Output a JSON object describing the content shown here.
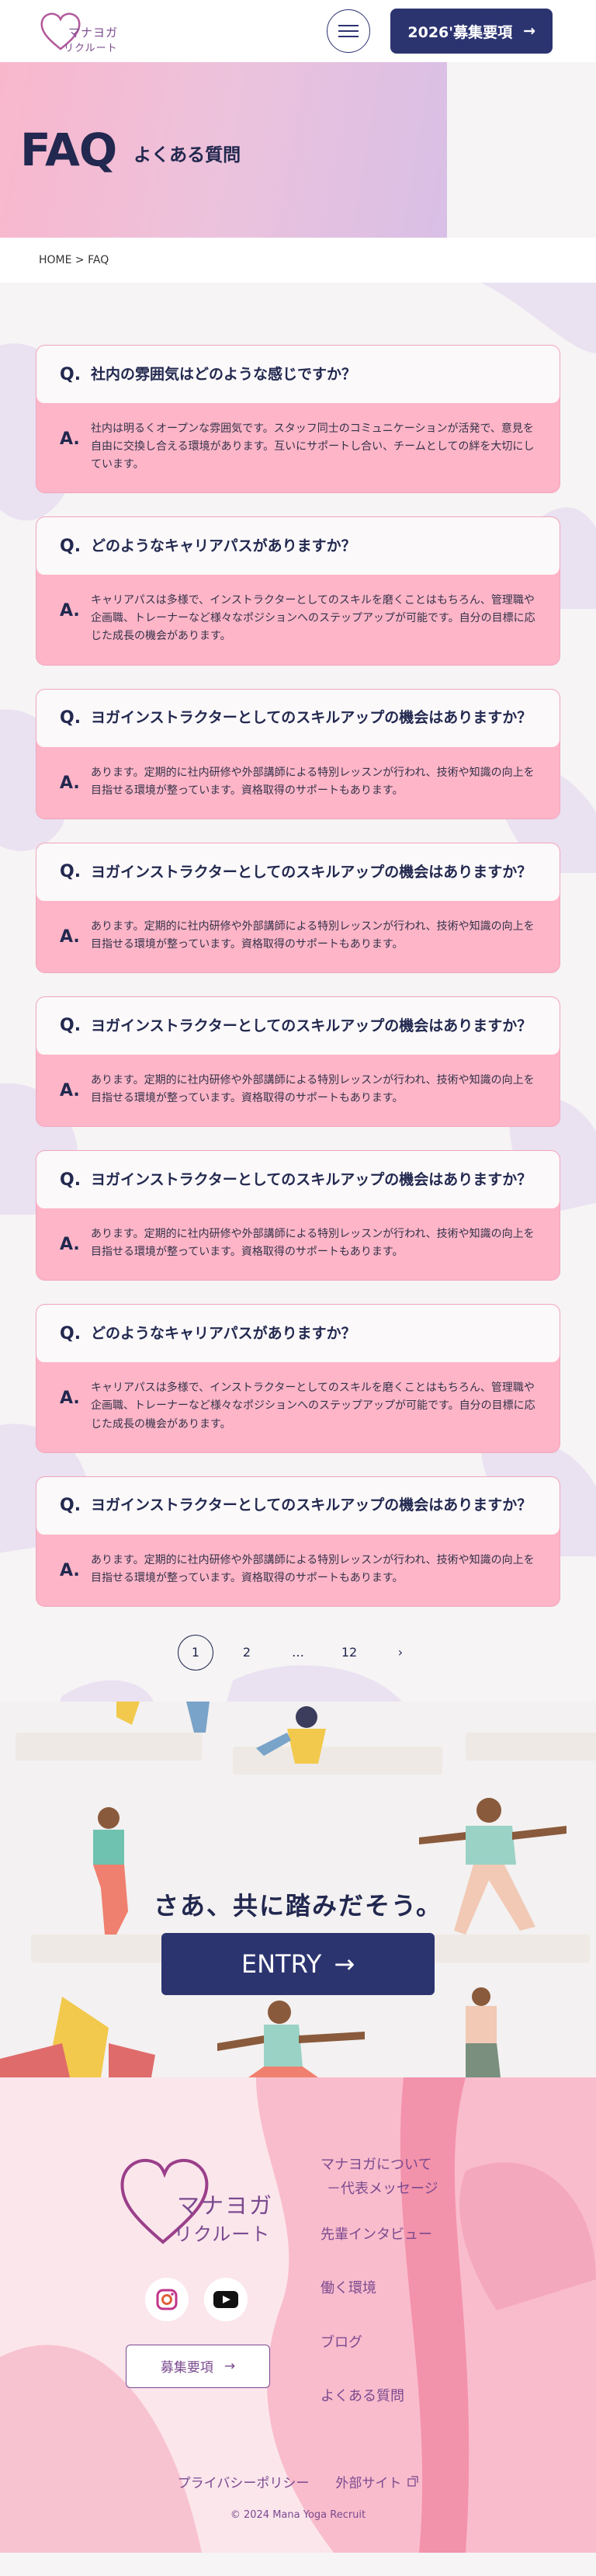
{
  "header": {
    "logo_line1": "マナヨガ",
    "logo_line2": "リクルート",
    "menu_label": "",
    "recruit_button": "2026'募集要項",
    "recruit_arrow": "→"
  },
  "hero": {
    "title": "FAQ",
    "subtitle": "よくある質問"
  },
  "breadcrumb": "HOME > FAQ",
  "faq": {
    "q_letter": "Q.",
    "a_letter": "A.",
    "items": [
      {
        "question": "社内の雰囲気はどのような感じですか？",
        "answer": "社内は明るくオープンな雰囲気です。スタッフ同士のコミュニケーションが活発で、意見を自由に交換し合える環境があります。互いにサポートし合い、チームとしての絆を大切にしています。"
      },
      {
        "question": "どのようなキャリアパスがありますか？",
        "answer": "キャリアパスは多様で、インストラクターとしてのスキルを磨くことはもちろん、管理職や企画職、トレーナーなど様々なポジションへのステップアップが可能です。自分の目標に応じた成長の機会があります。"
      },
      {
        "question": "ヨガインストラクターとしてのスキルアップの機会はありますか？",
        "answer": "あります。定期的に社内研修や外部講師による特別レッスンが行われ、技術や知識の向上を目指せる環境が整っています。資格取得のサポートもあります。"
      },
      {
        "question": "ヨガインストラクターとしてのスキルアップの機会はありますか？",
        "answer": "あります。定期的に社内研修や外部講師による特別レッスンが行われ、技術や知識の向上を目指せる環境が整っています。資格取得のサポートもあります。"
      },
      {
        "question": "ヨガインストラクターとしてのスキルアップの機会はありますか？",
        "answer": "あります。定期的に社内研修や外部講師による特別レッスンが行われ、技術や知識の向上を目指せる環境が整っています。資格取得のサポートもあります。"
      },
      {
        "question": "ヨガインストラクターとしてのスキルアップの機会はありますか？",
        "answer": "あります。定期的に社内研修や外部講師による特別レッスンが行われ、技術や知識の向上を目指せる環境が整っています。資格取得のサポートもあります。"
      },
      {
        "question": "どのようなキャリアパスがありますか？",
        "answer": "キャリアパスは多様で、インストラクターとしてのスキルを磨くことはもちろん、管理職や企画職、トレーナーなど様々なポジションへのステップアップが可能です。自分の目標に応じた成長の機会があります。"
      },
      {
        "question": "ヨガインストラクターとしてのスキルアップの機会はありますか？",
        "answer": "あります。定期的に社内研修や外部講師による特別レッスンが行われ、技術や知識の向上を目指せる環境が整っています。資格取得のサポートもあります。"
      }
    ]
  },
  "pagination": {
    "pages": [
      "1",
      "2",
      "…",
      "12"
    ],
    "current": "1",
    "next": "›"
  },
  "entry": {
    "heading": "さあ、共に踏みだそう。",
    "button": "ENTRY",
    "arrow": "→"
  },
  "footer": {
    "logo_line1": "マナヨガ",
    "logo_line2": "リクルート",
    "recruit_button": "募集要項",
    "recruit_arrow": "→",
    "nav": [
      "マナヨガについて",
      "－代表メッセージ",
      "先輩インタビュー",
      "働く環境",
      "ブログ",
      "よくある質問"
    ],
    "privacy": "プライバシーポリシー",
    "external": "外部サイト",
    "copyright": "© 2024 Mana Yoga Recruit"
  },
  "colors": {
    "navy": "#2c3470",
    "pink": "#ffb5c8",
    "purple": "#7b4a8f"
  }
}
